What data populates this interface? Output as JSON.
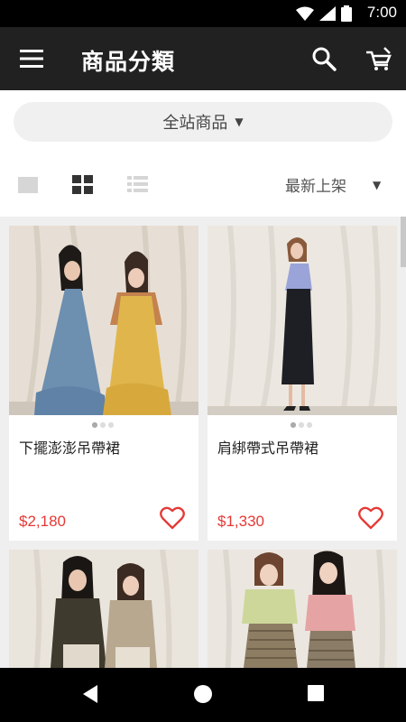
{
  "status_bar": {
    "time": "7:00"
  },
  "app_bar": {
    "title": "商品分類"
  },
  "filter": {
    "category_label": "全站商品",
    "sort_label": "最新上架"
  },
  "products": [
    {
      "name": "下擺澎澎吊帶裙",
      "price": "$2,180"
    },
    {
      "name": "肩綁帶式吊帶裙",
      "price": "$1,330"
    },
    {
      "name": "",
      "price": ""
    },
    {
      "name": "",
      "price": ""
    }
  ],
  "colors": {
    "accent": "#e53935",
    "app_bar": "#212121"
  },
  "icons": [
    "menu-icon",
    "search-icon",
    "cart-icon",
    "heart-icon",
    "wifi-icon",
    "signal-icon",
    "battery-icon",
    "back-icon",
    "home-icon",
    "recents-icon"
  ]
}
